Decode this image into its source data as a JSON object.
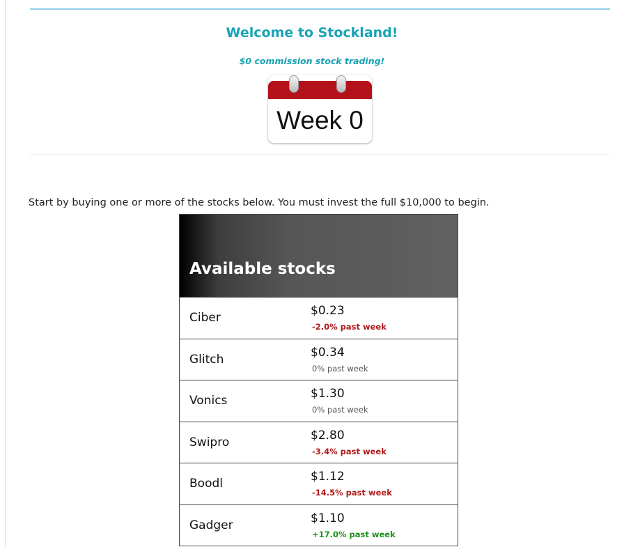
{
  "header": {
    "title": "Welcome to Stockland!",
    "subtitle": "$0 commission stock trading!",
    "week_label": "Week 0"
  },
  "intro_text": "Start by buying one or more of the stocks below. You must invest the full $10,000 to begin.",
  "stocks": {
    "title": "Available stocks",
    "rows": [
      {
        "name": "Ciber",
        "price": "$0.23",
        "change": "-2.0% past week"
      },
      {
        "name": "Glitch",
        "price": "$0.34",
        "change": "0% past week"
      },
      {
        "name": "Vonics",
        "price": "$1.30",
        "change": "0% past week"
      },
      {
        "name": "Swipro",
        "price": "$2.80",
        "change": "-3.4% past week"
      },
      {
        "name": "Boodl",
        "price": "$1.12",
        "change": "-14.5% past week"
      },
      {
        "name": "Gadger",
        "price": "$1.10",
        "change": "+17.0% past week"
      }
    ]
  },
  "colors": {
    "accent": "#17a3b4",
    "negative": "#b01a1a",
    "positive": "#1f8f1f",
    "neutral": "#555555",
    "calendar_red": "#b3121b"
  }
}
